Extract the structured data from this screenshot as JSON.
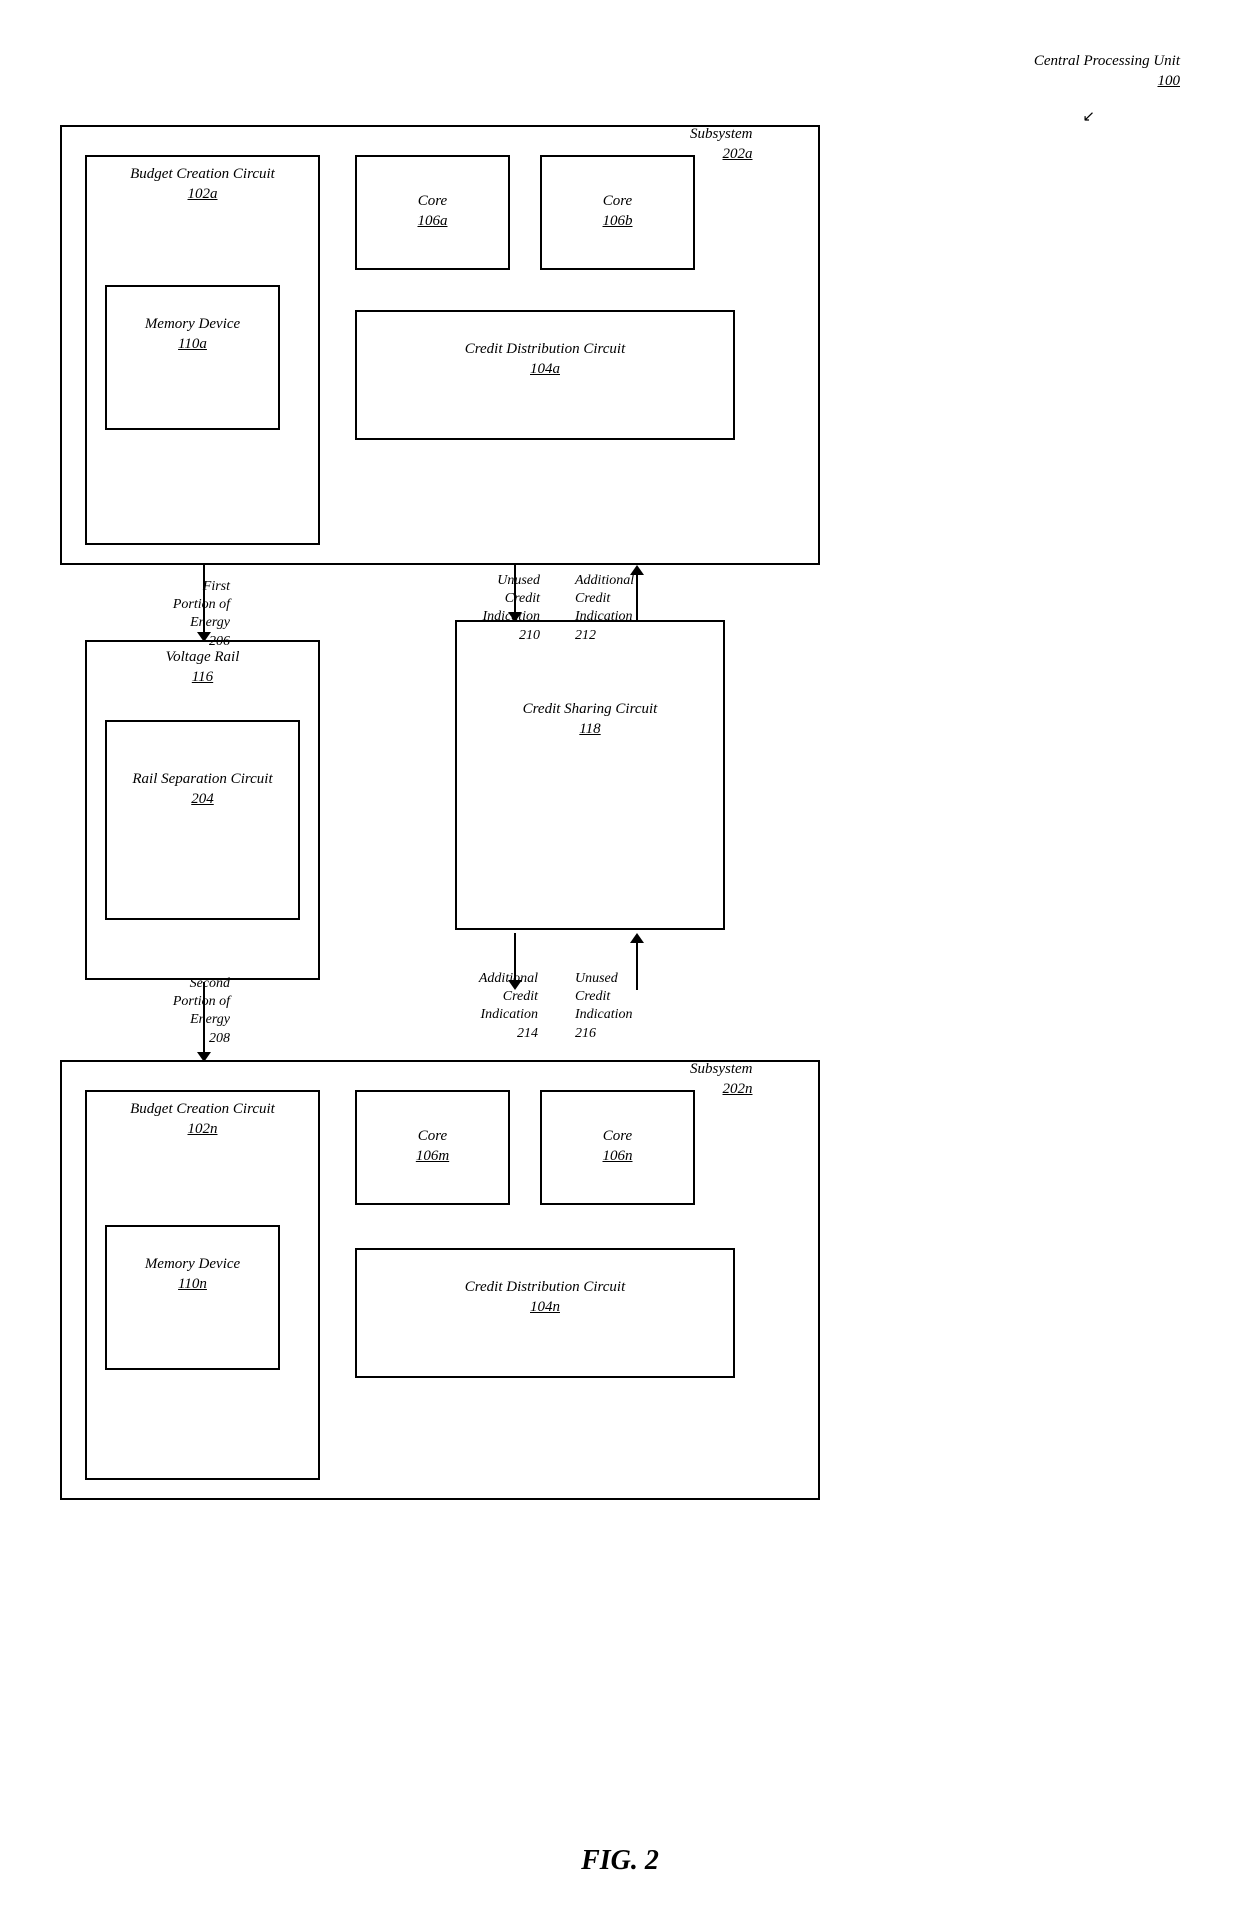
{
  "title": "FIG. 2",
  "cpu_label": "Central Processing Unit",
  "cpu_number": "100",
  "subsystem_a": {
    "label": "Subsystem",
    "number": "202a"
  },
  "subsystem_n": {
    "label": "Subsystem",
    "number": "202n"
  },
  "budget_circuit_a": {
    "label": "Budget Creation Circuit",
    "number": "102a"
  },
  "budget_circuit_n": {
    "label": "Budget Creation Circuit",
    "number": "102n"
  },
  "memory_a": {
    "label": "Memory Device",
    "number": "110a"
  },
  "memory_n": {
    "label": "Memory Device",
    "number": "110n"
  },
  "core_a": {
    "label": "Core",
    "number": "106a"
  },
  "core_b": {
    "label": "Core",
    "number": "106b"
  },
  "core_m": {
    "label": "Core",
    "number": "106m"
  },
  "core_n": {
    "label": "Core",
    "number": "106n"
  },
  "credit_dist_a": {
    "label": "Credit Distribution Circuit",
    "number": "104a"
  },
  "credit_dist_n": {
    "label": "Credit Distribution Circuit",
    "number": "104n"
  },
  "voltage_rail": {
    "label": "Voltage Rail",
    "number": "116"
  },
  "rail_sep": {
    "label": "Rail Separation Circuit",
    "number": "204"
  },
  "credit_sharing": {
    "label": "Credit Sharing Circuit",
    "number": "118"
  },
  "first_portion": {
    "label": "First Portion of Energy",
    "number": "206"
  },
  "second_portion": {
    "label": "Second Portion of Energy",
    "number": "208"
  },
  "unused_credit_210": {
    "label": "Unused Credit Indication",
    "number": "210"
  },
  "additional_credit_212": {
    "label": "Additional Credit Indication",
    "number": "212"
  },
  "additional_credit_214": {
    "label": "Additional Credit Indication",
    "number": "214"
  },
  "unused_credit_216": {
    "label": "Unused Credit Indication",
    "number": "216"
  }
}
